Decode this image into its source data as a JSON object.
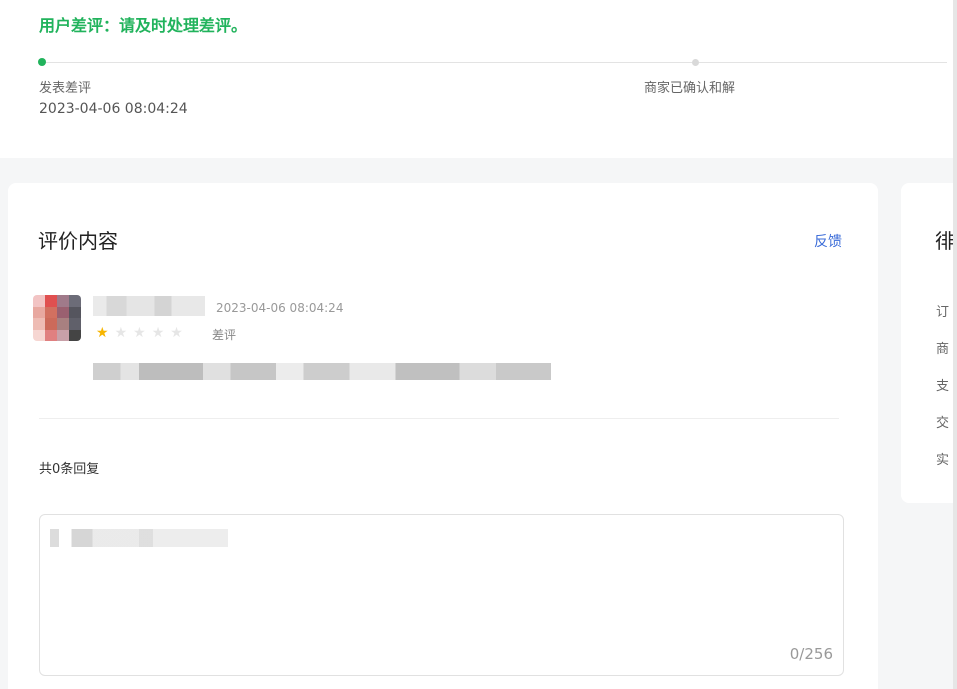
{
  "status": {
    "title": "用户差评：请及时处理差评。",
    "steps": [
      {
        "label": "发表差评",
        "time": "2023-04-06 08:04:24"
      },
      {
        "label": "商家已确认和解"
      }
    ]
  },
  "review": {
    "card_title": "评价内容",
    "feedback_label": "反馈",
    "time": "2023-04-06 08:04:24",
    "stars": 1,
    "stars_total": 5,
    "rating_label": "差评",
    "reply_count": "共0条回复",
    "reply_counter": "0/256"
  },
  "side_panel": {
    "title": "徘",
    "items": [
      "订",
      "商",
      "支",
      "交",
      "实"
    ]
  },
  "colors": {
    "accent_green": "#21b35c",
    "link_blue": "#3a6bd8",
    "star": "#f7b500"
  }
}
